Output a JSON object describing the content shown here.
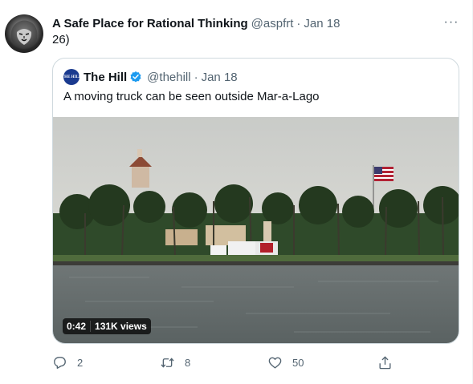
{
  "tweet": {
    "author_name": "A Safe Place for Rational Thinking",
    "author_handle": "@aspfrt",
    "separator": "·",
    "time": "Jan 18",
    "text": "26)",
    "more_label": "···"
  },
  "quote": {
    "avatar_text": "THE HILL",
    "author_name": "The Hill",
    "author_handle": "@thehill",
    "separator": "·",
    "time": "Jan 18",
    "text": "A moving truck can be seen outside Mar-a-Lago",
    "video": {
      "duration": "0:42",
      "views": "131K views"
    }
  },
  "actions": {
    "reply_count": "2",
    "retweet_count": "8",
    "like_count": "50",
    "share_count": ""
  },
  "icons": {
    "more": "more-dots-icon",
    "verified": "verified-badge-icon",
    "reply": "reply-icon",
    "retweet": "retweet-icon",
    "like": "heart-icon",
    "share": "share-icon"
  },
  "colors": {
    "secondary_text": "#536471",
    "verified_blue": "#1d9bf0",
    "border": "#cfd9de"
  }
}
